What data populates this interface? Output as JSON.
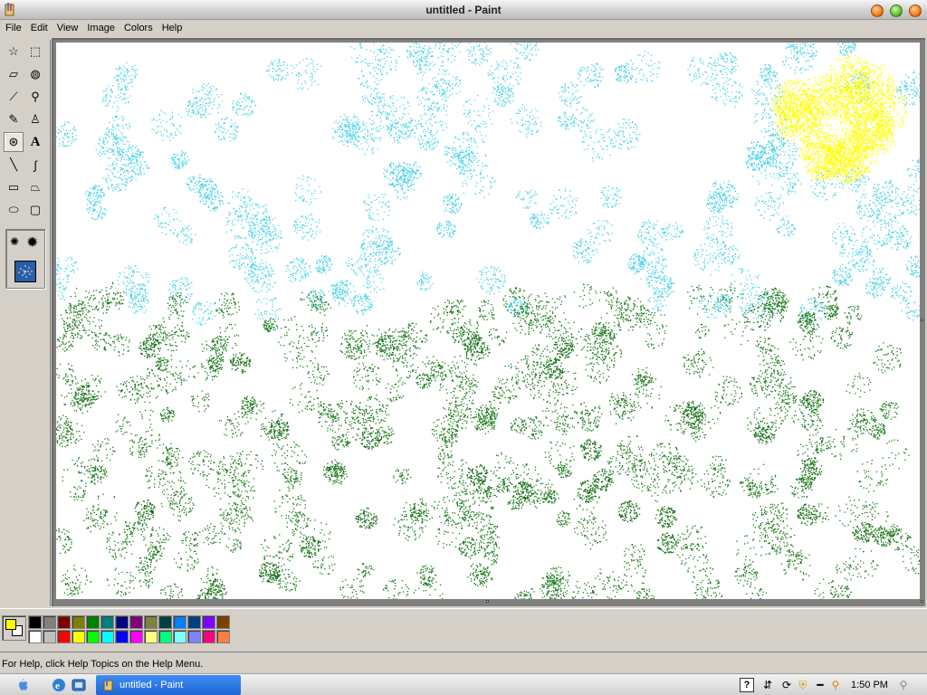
{
  "window": {
    "title": "untitled - Paint"
  },
  "menu": {
    "items": [
      "File",
      "Edit",
      "View",
      "Image",
      "Colors",
      "Help"
    ]
  },
  "toolbox": {
    "tools": [
      {
        "name": "free-form-select-icon",
        "glyph": "☆",
        "active": false
      },
      {
        "name": "select-icon",
        "glyph": "⬚",
        "active": false
      },
      {
        "name": "eraser-icon",
        "glyph": "▱",
        "active": false
      },
      {
        "name": "fill-with-color-icon",
        "glyph": "◍",
        "active": false
      },
      {
        "name": "pick-color-icon",
        "glyph": "⟋",
        "active": false
      },
      {
        "name": "magnifier-icon",
        "glyph": "⚲",
        "active": false
      },
      {
        "name": "pencil-icon",
        "glyph": "✎",
        "active": false
      },
      {
        "name": "brush-icon",
        "glyph": "♙",
        "active": false
      },
      {
        "name": "airbrush-icon",
        "glyph": "⊛",
        "active": true
      },
      {
        "name": "text-icon",
        "glyph": "A",
        "active": false
      },
      {
        "name": "line-icon",
        "glyph": "╲",
        "active": false
      },
      {
        "name": "curve-icon",
        "glyph": "∫",
        "active": false
      },
      {
        "name": "rectangle-icon",
        "glyph": "▭",
        "active": false
      },
      {
        "name": "polygon-icon",
        "glyph": "⏢",
        "active": false
      },
      {
        "name": "ellipse-icon",
        "glyph": "⬭",
        "active": false
      },
      {
        "name": "rounded-rectangle-icon",
        "glyph": "▢",
        "active": false
      }
    ]
  },
  "colors": {
    "foreground": "#ffff00",
    "background": "#ffffff",
    "palette": [
      "#000000",
      "#808080",
      "#800000",
      "#808000",
      "#008000",
      "#008080",
      "#000080",
      "#800080",
      "#808040",
      "#004040",
      "#0080ff",
      "#004080",
      "#8000ff",
      "#804000",
      "#ffffff",
      "#c0c0c0",
      "#ff0000",
      "#ffff00",
      "#00ff00",
      "#00ffff",
      "#0000ff",
      "#ff00ff",
      "#ffff80",
      "#00ff80",
      "#80ffff",
      "#8080ff",
      "#ff0080",
      "#ff8040"
    ]
  },
  "status": {
    "help_text": "For Help, click Help Topics on the Help Menu."
  },
  "taskbar": {
    "task_label": "untitled - Paint",
    "clock": "1:50 PM"
  }
}
